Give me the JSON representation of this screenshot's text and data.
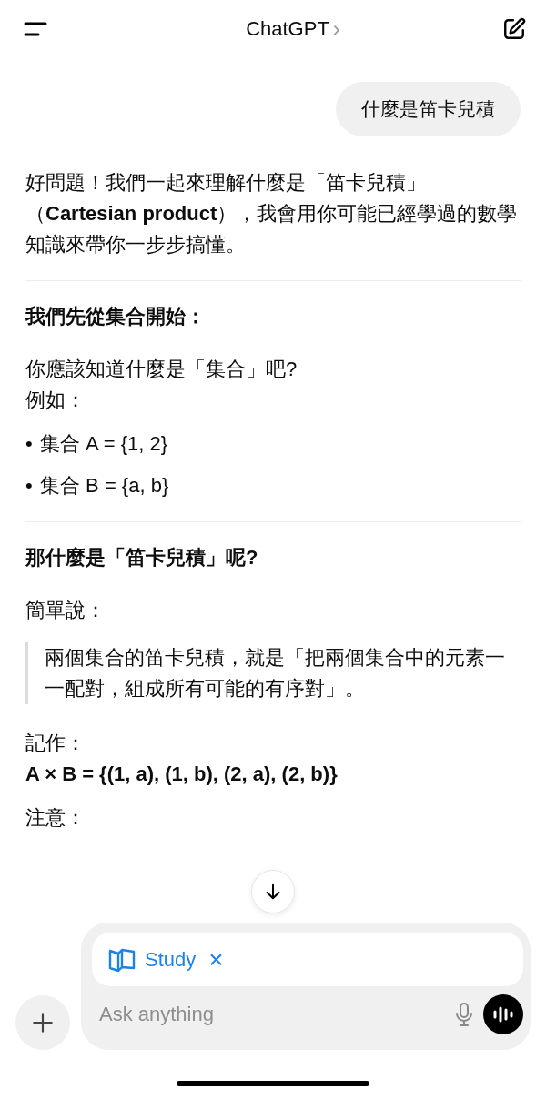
{
  "header": {
    "title": "ChatGPT",
    "chevron": "›"
  },
  "user_message": "什麼是笛卡兒積",
  "blocks": [
    {
      "kind": "paragraph",
      "lines": [
        {
          "text": "好問題！我們一起來理解什麼是「笛卡兒積」（**Cartesian product**），我會用你可能已經學過的數學知識來帶你一步步搞懂。",
          "bold": false
        }
      ]
    },
    {
      "kind": "divider"
    },
    {
      "kind": "heading",
      "text": "我們先從集合開始："
    },
    {
      "kind": "paragraph",
      "lines": [
        {
          "text": "你應該知道什麼是「集合」吧?",
          "bold": false
        },
        {
          "text": "例如：",
          "bold": false
        }
      ]
    },
    {
      "kind": "bullet",
      "bullet": "•",
      "text": "集合 A = {1, 2}"
    },
    {
      "kind": "bullet",
      "bullet": "•",
      "text": "集合 B = {a, b}"
    },
    {
      "kind": "divider"
    },
    {
      "kind": "heading",
      "text": "那什麼是「笛卡兒積」呢?"
    },
    {
      "kind": "paragraph",
      "lines": [
        {
          "text": "簡單說：",
          "bold": false
        }
      ]
    },
    {
      "kind": "quote",
      "text": "兩個集合的笛卡兒積，就是「把兩個集合中的元素一一配對，組成所有可能的有序對」。"
    },
    {
      "kind": "paragraph",
      "lines": [
        {
          "text": "記作：",
          "bold": false
        },
        {
          "text": "A × B = {(1, a), (1, b), (2, a), (2, b)}",
          "bold": true
        }
      ]
    },
    {
      "kind": "paragraph",
      "lines": [
        {
          "text": "注意：",
          "bold": false
        }
      ]
    }
  ],
  "composer": {
    "tool": {
      "label": "Study",
      "remove": "×"
    },
    "placeholder": "Ask anything"
  }
}
